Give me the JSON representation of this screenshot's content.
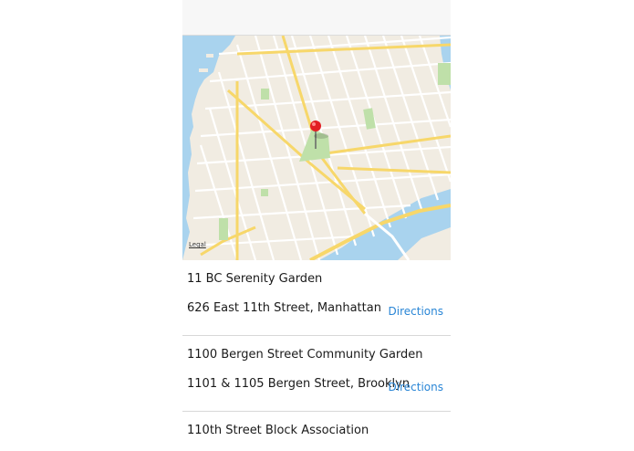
{
  "map": {
    "legal_label": "Legal",
    "water_color": "#a9d3ee",
    "land_color": "#f1ece2",
    "park_color": "#bfe0a9",
    "road_color": "#f7d76a",
    "pin_color": "#e21f23"
  },
  "gardens": [
    {
      "name": "11 BC Serenity Garden",
      "address": "626 East 11th Street, Manhattan",
      "directions_label": "Directions"
    },
    {
      "name": "1100 Bergen Street Community Garden",
      "address": "1101 & 1105 Bergen Street, Brooklyn",
      "directions_label": "Directions"
    },
    {
      "name": "110th Street Block Association"
    }
  ]
}
